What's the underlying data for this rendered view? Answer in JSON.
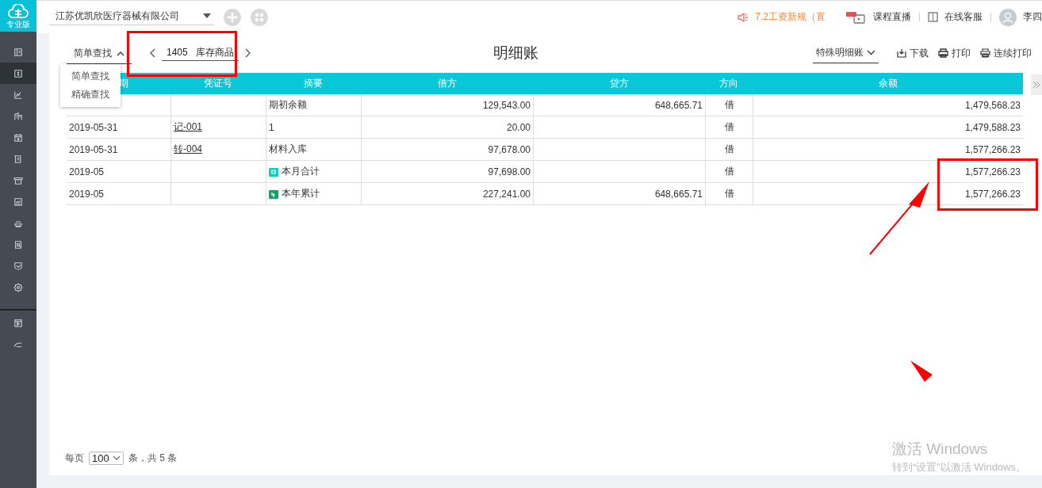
{
  "sidebar": {
    "logo_label": "专业版",
    "items": [
      {
        "selected": false
      },
      {
        "selected": true
      },
      {
        "selected": false
      },
      {
        "selected": false
      },
      {
        "selected": false
      },
      {
        "selected": false
      },
      {
        "selected": false
      },
      {
        "selected": false
      },
      {
        "selected": false
      },
      {
        "selected": false
      },
      {
        "selected": false
      },
      {
        "selected": false
      }
    ],
    "bottom_items": [
      {
        "selected": false
      },
      {
        "selected": false
      }
    ]
  },
  "topbar": {
    "company": "江苏优凯欣医疗器械有限公司",
    "notice": "7.2工资新规（直",
    "links": [
      {
        "kind": "live",
        "label": "课程直播"
      },
      {
        "kind": "service",
        "label": "在线客服"
      }
    ],
    "user": "李四"
  },
  "toolbar": {
    "search_mode": "简单查找",
    "search_menu": [
      "简单查找",
      "精确查找"
    ],
    "account": "1405   库存商品",
    "title": "明细账",
    "special": "特殊明细账",
    "actions": [
      {
        "kind": "download",
        "label": "下载"
      },
      {
        "kind": "print",
        "label": "打印"
      },
      {
        "kind": "batch_print",
        "label": "连续打印"
      }
    ]
  },
  "table": {
    "columns": [
      "期",
      "凭证号",
      "摘要",
      "借方",
      "贷方",
      "方向",
      "余额"
    ],
    "rows": [
      {
        "kind": "opening",
        "voucher": null,
        "summary": "期初余额",
        "debit": "129,543.00",
        "credit": "648,665.71",
        "direction": "借",
        "balance": "1,479,568.23"
      },
      {
        "kind": "entry",
        "date": "2019-05-31",
        "voucher": "记-001",
        "summary": "1",
        "debit": "20.00",
        "credit": null,
        "direction": "借",
        "balance": "1,479,588.23"
      },
      {
        "kind": "entry",
        "date": "2019-05-31",
        "voucher": "转-004",
        "summary": "材料入库",
        "debit": "97,678.00",
        "credit": null,
        "direction": "借",
        "balance": "1,577,266.23"
      },
      {
        "kind": "month_total",
        "date": "2019-05",
        "voucher": null,
        "summary": "本月合计",
        "debit": "97,698.00",
        "credit": null,
        "direction": "借",
        "balance": "1,577,266.23"
      },
      {
        "kind": "year_total",
        "date": "2019-05",
        "voucher": null,
        "summary": "本年累计",
        "debit": "227,241.00",
        "credit": "648,665.71",
        "direction": "借",
        "balance": "1,577,266.23"
      }
    ]
  },
  "pagination": {
    "per_page_label": "每页",
    "per_page": "100",
    "summary": "条，共 5 条"
  },
  "system_notice": {
    "title": "激活 Windows",
    "text": "转到“设置”以激活 Windows。"
  }
}
